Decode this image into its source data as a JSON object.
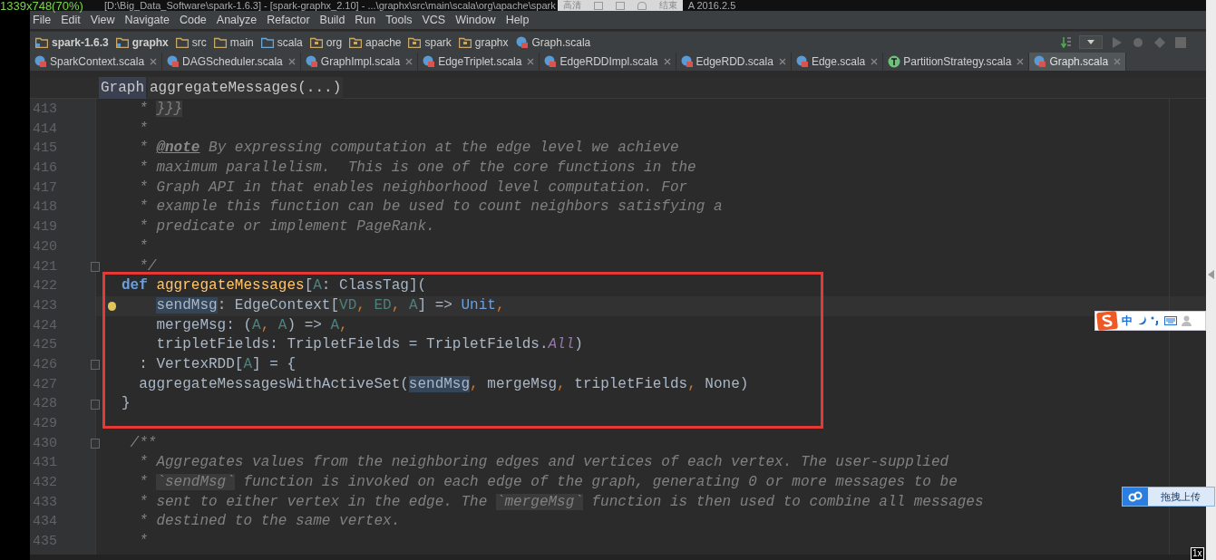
{
  "recorder_overlay": {
    "size": "1339x748(70%)",
    "buttons": [
      "高清",
      "结束"
    ]
  },
  "window": {
    "title": "[D:\\Big_Data_Software\\spark-1.6.3] - [spark-graphx_2.10] - ...\\graphx\\src\\main\\scala\\org\\apache\\spark",
    "title_end": "A 2016.2.5"
  },
  "menu": [
    "File",
    "Edit",
    "View",
    "Navigate",
    "Code",
    "Analyze",
    "Refactor",
    "Build",
    "Run",
    "Tools",
    "VCS",
    "Window",
    "Help"
  ],
  "nav_bar": [
    {
      "label": "spark-1.6.3",
      "kind": "module"
    },
    {
      "label": "graphx",
      "kind": "module"
    },
    {
      "label": "src",
      "kind": "folder"
    },
    {
      "label": "main",
      "kind": "folder"
    },
    {
      "label": "scala",
      "kind": "source"
    },
    {
      "label": "org",
      "kind": "package"
    },
    {
      "label": "apache",
      "kind": "package"
    },
    {
      "label": "spark",
      "kind": "package"
    },
    {
      "label": "graphx",
      "kind": "package"
    },
    {
      "label": "Graph.scala",
      "kind": "file"
    }
  ],
  "tabs": [
    {
      "label": "SparkContext.scala",
      "kind": "class",
      "selected": false
    },
    {
      "label": "DAGScheduler.scala",
      "kind": "class",
      "selected": false
    },
    {
      "label": "GraphImpl.scala",
      "kind": "class",
      "selected": false
    },
    {
      "label": "EdgeTriplet.scala",
      "kind": "class",
      "selected": false
    },
    {
      "label": "EdgeRDDImpl.scala",
      "kind": "class",
      "selected": false
    },
    {
      "label": "EdgeRDD.scala",
      "kind": "class",
      "selected": false
    },
    {
      "label": "Edge.scala",
      "kind": "class",
      "selected": false
    },
    {
      "label": "PartitionStrategy.scala",
      "kind": "trait",
      "selected": false
    },
    {
      "label": "Graph.scala",
      "kind": "class",
      "selected": true
    }
  ],
  "breadcrumb": [
    "Graph",
    "aggregateMessages(...)"
  ],
  "editor": {
    "lines": [
      {
        "number": "413",
        "fold": false,
        "bulb": false,
        "current": false,
        "tokens": [
          {
            "text": "  * ",
            "kind": "comment"
          },
          {
            "text": "}}}",
            "kind": "comment_code"
          }
        ]
      },
      {
        "number": "414",
        "fold": false,
        "bulb": false,
        "current": false,
        "tokens": [
          {
            "text": "  *",
            "kind": "comment"
          }
        ]
      },
      {
        "number": "415",
        "fold": false,
        "bulb": false,
        "current": false,
        "tokens": [
          {
            "text": "  * ",
            "kind": "comment"
          },
          {
            "text": "@note",
            "kind": "doctag"
          },
          {
            "text": " By expressing computation at the edge level we achieve",
            "kind": "comment"
          }
        ]
      },
      {
        "number": "416",
        "fold": false,
        "bulb": false,
        "current": false,
        "tokens": [
          {
            "text": "  * maximum parallelism.  This is one of the core functions in the",
            "kind": "comment"
          }
        ]
      },
      {
        "number": "417",
        "fold": false,
        "bulb": false,
        "current": false,
        "tokens": [
          {
            "text": "  * Graph API in that enables neighborhood level computation. For",
            "kind": "comment"
          }
        ]
      },
      {
        "number": "418",
        "fold": false,
        "bulb": false,
        "current": false,
        "tokens": [
          {
            "text": "  * example this function can be used to count neighbors satisfying a",
            "kind": "comment"
          }
        ]
      },
      {
        "number": "419",
        "fold": false,
        "bulb": false,
        "current": false,
        "tokens": [
          {
            "text": "  * predicate or implement PageRank.",
            "kind": "comment"
          }
        ]
      },
      {
        "number": "420",
        "fold": false,
        "bulb": false,
        "current": false,
        "tokens": [
          {
            "text": "  *",
            "kind": "comment"
          }
        ]
      },
      {
        "number": "421",
        "fold": true,
        "bulb": false,
        "current": false,
        "tokens": [
          {
            "text": "  */",
            "kind": "comment"
          }
        ]
      },
      {
        "number": "422",
        "fold": false,
        "bulb": false,
        "current": false,
        "tokens": [
          {
            "text": "def",
            "kind": "keyword"
          },
          {
            "text": " aggregateMessages",
            "kind": "function"
          },
          {
            "text": "[",
            "kind": "plain"
          },
          {
            "text": "A",
            "kind": "tparam"
          },
          {
            "text": ": ClassTag](",
            "kind": "plain"
          }
        ]
      },
      {
        "number": "423",
        "fold": false,
        "bulb": true,
        "current": true,
        "tokens": [
          {
            "text": "    sendMsg",
            "kind": "usage"
          },
          {
            "text": ": EdgeContext[",
            "kind": "plain"
          },
          {
            "text": "VD",
            "kind": "tparam"
          },
          {
            "text": ",",
            "kind": "comma"
          },
          {
            "text": " ED",
            "kind": "tparam"
          },
          {
            "text": ",",
            "kind": "comma"
          },
          {
            "text": " A",
            "kind": "tparam"
          },
          {
            "text": "] => ",
            "kind": "plain"
          },
          {
            "text": "Unit",
            "kind": "type"
          },
          {
            "text": ",",
            "kind": "comma"
          }
        ]
      },
      {
        "number": "424",
        "fold": false,
        "bulb": false,
        "current": false,
        "tokens": [
          {
            "text": "    mergeMsg: (",
            "kind": "plain"
          },
          {
            "text": "A",
            "kind": "tparam"
          },
          {
            "text": ",",
            "kind": "comma"
          },
          {
            "text": " A",
            "kind": "tparam"
          },
          {
            "text": ") => ",
            "kind": "plain"
          },
          {
            "text": "A",
            "kind": "tparam"
          },
          {
            "text": ",",
            "kind": "comma"
          }
        ]
      },
      {
        "number": "425",
        "fold": false,
        "bulb": false,
        "current": false,
        "tokens": [
          {
            "text": "    tripletFields: TripletFields = TripletFields.",
            "kind": "plain"
          },
          {
            "text": "All",
            "kind": "constant"
          },
          {
            "text": ")",
            "kind": "plain"
          }
        ]
      },
      {
        "number": "426",
        "fold": true,
        "bulb": false,
        "current": false,
        "tokens": [
          {
            "text": "  : VertexRDD[",
            "kind": "plain"
          },
          {
            "text": "A",
            "kind": "tparam"
          },
          {
            "text": "] = {",
            "kind": "plain"
          }
        ]
      },
      {
        "number": "427",
        "fold": false,
        "bulb": false,
        "current": false,
        "tokens": [
          {
            "text": "  aggregateMessagesWithActiveSet(",
            "kind": "plain"
          },
          {
            "text": "sendMsg",
            "kind": "usage"
          },
          {
            "text": ",",
            "kind": "comma"
          },
          {
            "text": " mergeMsg",
            "kind": "plain"
          },
          {
            "text": ",",
            "kind": "comma"
          },
          {
            "text": " tripletFields",
            "kind": "plain"
          },
          {
            "text": ",",
            "kind": "comma"
          },
          {
            "text": " None)",
            "kind": "plain"
          }
        ]
      },
      {
        "number": "428",
        "fold": true,
        "bulb": false,
        "current": false,
        "tokens": [
          {
            "text": "}",
            "kind": "plain"
          }
        ]
      },
      {
        "number": "429",
        "fold": false,
        "bulb": false,
        "current": false
      },
      {
        "number": "430",
        "fold": true,
        "bulb": false,
        "current": false,
        "tokens": [
          {
            "text": " /**",
            "kind": "comment"
          }
        ]
      },
      {
        "number": "431",
        "fold": false,
        "bulb": false,
        "current": false,
        "tokens": [
          {
            "text": "  * Aggregates values from the neighboring edges and vertices of each vertex. The user-supplied",
            "kind": "comment"
          }
        ]
      },
      {
        "number": "432",
        "fold": false,
        "bulb": false,
        "current": false,
        "tokens": [
          {
            "text": "  * ",
            "kind": "comment"
          },
          {
            "text": "`sendMsg`",
            "kind": "comment_code"
          },
          {
            "text": " function is invoked on each edge of the graph, generating 0 or more messages to be",
            "kind": "comment"
          }
        ]
      },
      {
        "number": "433",
        "fold": false,
        "bulb": false,
        "current": false,
        "tokens": [
          {
            "text": "  * sent to either vertex in the edge. The ",
            "kind": "comment"
          },
          {
            "text": "`mergeMsg`",
            "kind": "comment_code"
          },
          {
            "text": " function is then used to combine all messages",
            "kind": "comment"
          }
        ]
      },
      {
        "number": "434",
        "fold": false,
        "bulb": false,
        "current": false,
        "tokens": [
          {
            "text": "  * destined to the same vertex.",
            "kind": "comment"
          }
        ]
      },
      {
        "number": "435",
        "fold": false,
        "bulb": false,
        "current": false,
        "tokens": [
          {
            "text": "  *",
            "kind": "comment"
          }
        ]
      }
    ]
  },
  "ime_bar": {
    "mode": "中"
  },
  "upload_button": {
    "label": "拖拽上传"
  },
  "zoom_badge": "1x"
}
